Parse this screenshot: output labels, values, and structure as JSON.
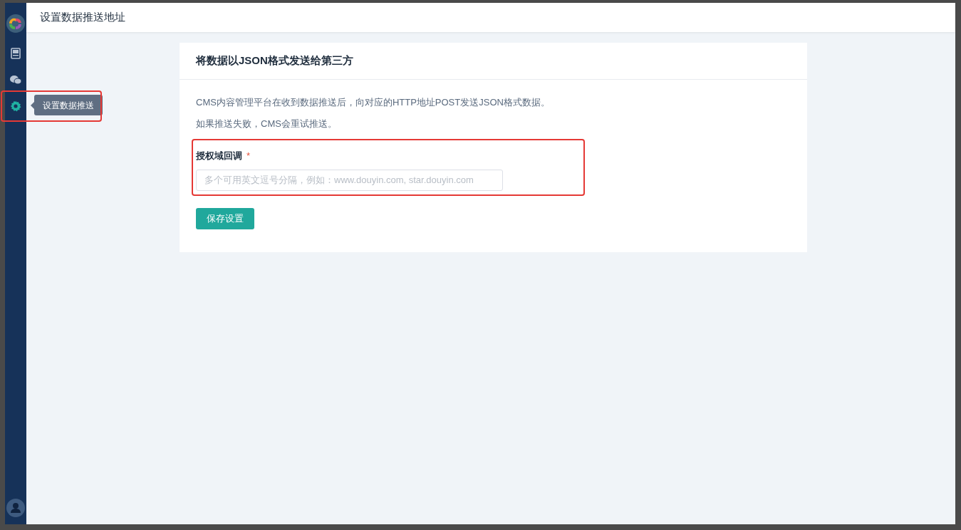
{
  "sidebar": {
    "items": [
      {
        "kind": "image",
        "selected": false
      },
      {
        "kind": "chat",
        "selected": false
      },
      {
        "kind": "settings",
        "selected": true,
        "tooltip": "设置数据推送"
      }
    ]
  },
  "header": {
    "title": "设置数据推送地址"
  },
  "card": {
    "title": "将数据以JSON格式发送给第三方",
    "descriptions": [
      "CMS内容管理平台在收到数据推送后，向对应的HTTP地址POST发送JSON格式数据。",
      "如果推送失败，CMS会重试推送。"
    ],
    "field": {
      "label": "授权域回调",
      "required": true,
      "required_mark": "*",
      "placeholder": "多个可用英文逗号分隔，例如：www.douyin.com, star.douyin.com"
    },
    "save_button": "保存设置"
  }
}
